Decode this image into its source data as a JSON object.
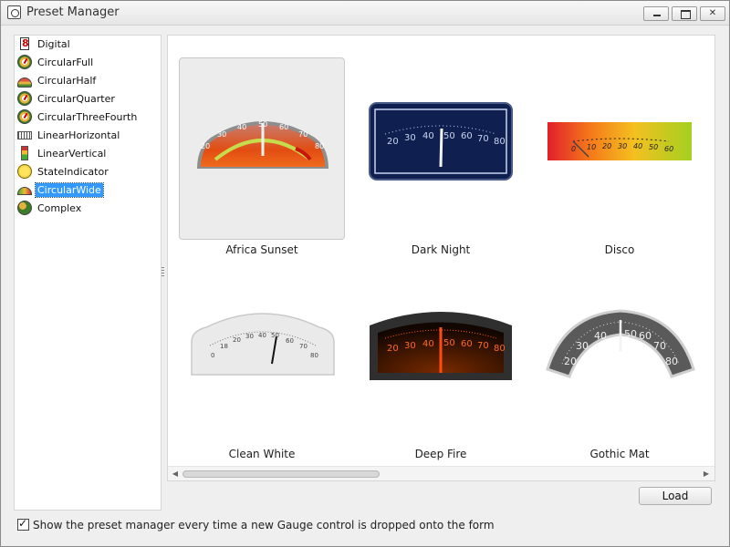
{
  "window": {
    "title": "Preset Manager",
    "controls": {
      "minimize": "",
      "maximize": "",
      "close": "✕"
    }
  },
  "tree": {
    "items": [
      {
        "label": "Digital",
        "icon": "digital-gauge-icon",
        "selected": false
      },
      {
        "label": "CircularFull",
        "icon": "circular-full-gauge-icon",
        "selected": false
      },
      {
        "label": "CircularHalf",
        "icon": "circular-half-gauge-icon",
        "selected": false
      },
      {
        "label": "CircularQuarter",
        "icon": "circular-quarter-gauge-icon",
        "selected": false
      },
      {
        "label": "CircularThreeFourth",
        "icon": "circular-three-fourth-gauge-icon",
        "selected": false
      },
      {
        "label": "LinearHorizontal",
        "icon": "linear-horizontal-gauge-icon",
        "selected": false
      },
      {
        "label": "LinearVertical",
        "icon": "linear-vertical-gauge-icon",
        "selected": false
      },
      {
        "label": "StateIndicator",
        "icon": "state-indicator-icon",
        "selected": false
      },
      {
        "label": "CircularWide",
        "icon": "circular-wide-gauge-icon",
        "selected": true
      },
      {
        "label": "Complex",
        "icon": "complex-gauge-icon",
        "selected": false
      }
    ]
  },
  "gallery": {
    "presets": [
      {
        "name": "Africa Sunset",
        "selected": true,
        "scale": [
          "20",
          "30",
          "40",
          "50",
          "60",
          "70",
          "80"
        ],
        "needle_value": 50
      },
      {
        "name": "Dark Night",
        "selected": false,
        "scale": [
          "20",
          "30",
          "40",
          "50",
          "60",
          "70",
          "80"
        ],
        "needle_value": 50
      },
      {
        "name": "Disco",
        "selected": false,
        "scale": [
          "0",
          "10",
          "20",
          "30",
          "40",
          "50",
          "60"
        ],
        "needle_value": 0
      },
      {
        "name": "Clean White",
        "selected": false,
        "scale": [
          "0",
          "18",
          "20",
          "30",
          "40",
          "50",
          "60",
          "70",
          "80"
        ],
        "needle_value": 50
      },
      {
        "name": "Deep Fire",
        "selected": false,
        "scale": [
          "20",
          "30",
          "40",
          "50",
          "60",
          "70",
          "80"
        ],
        "needle_value": 50
      },
      {
        "name": "Gothic Mat",
        "selected": false,
        "scale": [
          "20",
          "30",
          "40",
          "50",
          "60",
          "70",
          "80"
        ],
        "needle_value": 50
      }
    ],
    "scroll_arrows": {
      "left": "◀",
      "right": "▶"
    }
  },
  "buttons": {
    "load": "Load"
  },
  "footer": {
    "checkbox_checked": true,
    "checkbox_label": "Show the preset manager every time a new Gauge control is dropped onto the form"
  },
  "colors": {
    "selection": "#3399ff",
    "accent_orange": "#e8520f",
    "dark_navy": "#14265a"
  }
}
